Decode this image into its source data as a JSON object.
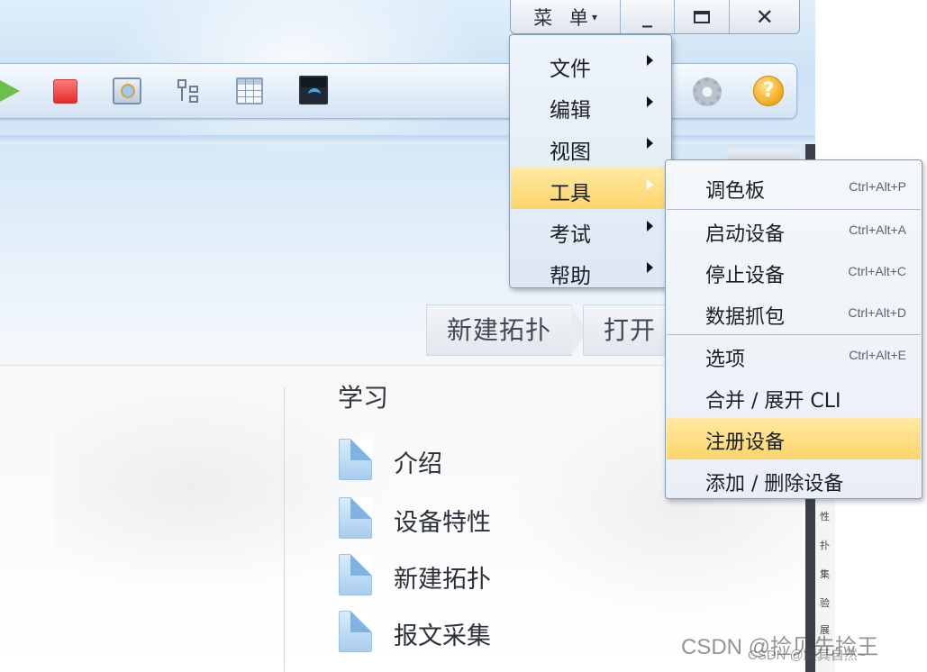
{
  "window_controls": {
    "menu_label": "菜 单",
    "menu_caret": "▾",
    "minimize_label": "_",
    "close_label": "✕"
  },
  "toolbar": {
    "icons": [
      "play-icon",
      "stop-icon",
      "capture-icon",
      "topology-icon",
      "grid-icon",
      "screen-icon",
      "gear-icon",
      "help-icon"
    ],
    "help_glyph": "?"
  },
  "main_menu": {
    "items": [
      {
        "label": "文件"
      },
      {
        "label": "编辑"
      },
      {
        "label": "视图"
      },
      {
        "label": "工具",
        "active": true
      },
      {
        "label": "考试"
      },
      {
        "label": "帮助"
      }
    ]
  },
  "tools_submenu": {
    "items": [
      {
        "label": "调色板",
        "shortcut": "Ctrl+Alt+P"
      },
      {
        "label": "启动设备",
        "shortcut": "Ctrl+Alt+A"
      },
      {
        "label": "停止设备",
        "shortcut": "Ctrl+Alt+C"
      },
      {
        "label": "数据抓包",
        "shortcut": "Ctrl+Alt+D"
      },
      {
        "label": "选项",
        "shortcut": "Ctrl+Alt+E"
      },
      {
        "label": "合并 / 展开 CLI",
        "shortcut": ""
      },
      {
        "label": "注册设备",
        "shortcut": "",
        "active": true
      },
      {
        "label": "添加 / 删除设备",
        "shortcut": ""
      }
    ]
  },
  "quick_tabs": [
    "新建拓扑",
    "打开"
  ],
  "learn": {
    "title": "学习",
    "items": [
      "介绍",
      "设备特性",
      "新建拓扑",
      "报文采集"
    ]
  },
  "right_panel_chars": [
    "性",
    "扑",
    "集",
    "验",
    "展"
  ],
  "watermark": {
    "line1": "CSDN @捡贝先捡王",
    "line2": "CSDN @顺其自然~"
  },
  "colors": {
    "highlight": "#fdd46a",
    "menu_border": "#7e9cbc"
  }
}
